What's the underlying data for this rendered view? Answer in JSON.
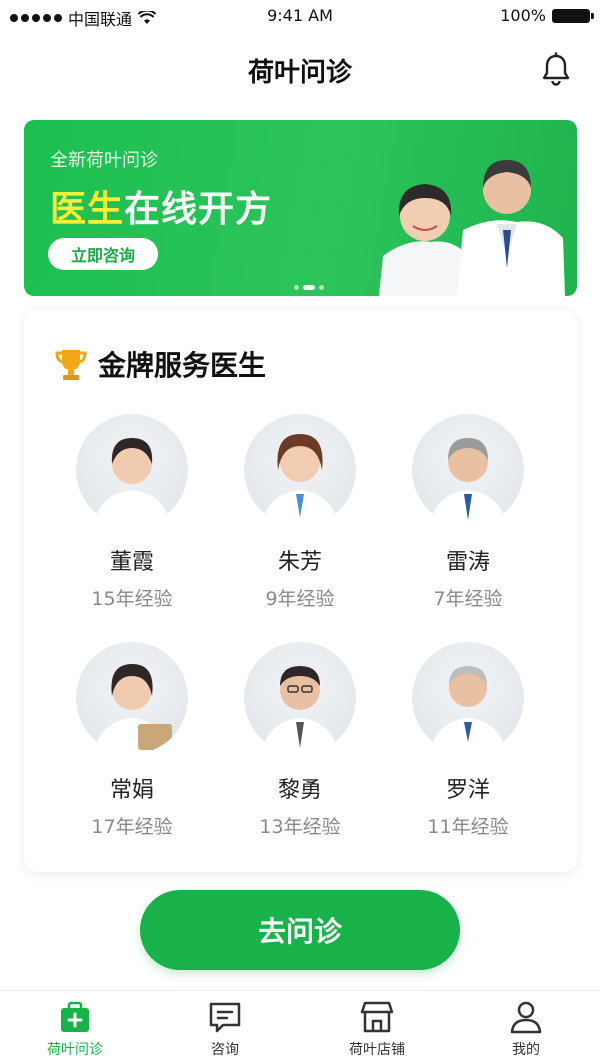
{
  "status_bar": {
    "carrier": "中国联通",
    "time": "9:41 AM",
    "battery": "100%"
  },
  "nav": {
    "title": "荷叶问诊",
    "bell_icon": "bell-icon"
  },
  "banner": {
    "subtitle": "全新荷叶问诊",
    "title_highlight": "医生",
    "title_rest": "在线开方",
    "button_label": "立即咨询",
    "highlight_color": "#f7ee3a",
    "bg_color": "#22bd52"
  },
  "section": {
    "title": "金牌服务医生",
    "icon": "trophy-icon"
  },
  "doctors": [
    {
      "name": "董霞",
      "experience": "15年经验"
    },
    {
      "name": "朱芳",
      "experience": "9年经验"
    },
    {
      "name": "雷涛",
      "experience": "7年经验"
    },
    {
      "name": "常娟",
      "experience": "17年经验"
    },
    {
      "name": "黎勇",
      "experience": "13年经验"
    },
    {
      "name": "罗洋",
      "experience": "11年经验"
    }
  ],
  "cta": {
    "label": "去问诊",
    "color": "#19b14a"
  },
  "tabs": [
    {
      "label": "荷叶问诊",
      "icon": "medical-kit-icon",
      "active": true
    },
    {
      "label": "咨询",
      "icon": "message-icon",
      "active": false
    },
    {
      "label": "荷叶店铺",
      "icon": "store-icon",
      "active": false
    },
    {
      "label": "我的",
      "icon": "user-icon",
      "active": false
    }
  ]
}
